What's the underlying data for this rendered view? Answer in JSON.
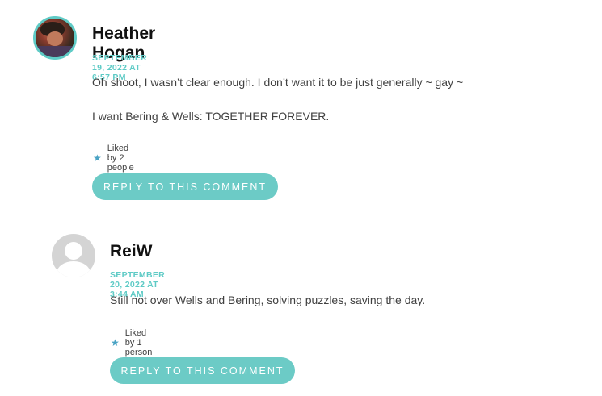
{
  "comments": [
    {
      "author": "Heather Hogan",
      "date": "SEPTEMBER 19, 2022 AT 6:57 PM",
      "paragraphs": [
        "Oh shoot, I wasn’t clear enough. I don’t want it to be just generally ~ gay ~",
        "I want Bering & Wells: TOGETHER FOREVER."
      ],
      "likes": "Liked by 2 people",
      "reply_label": "REPLY TO THIS COMMENT",
      "avatar": "user-photo"
    },
    {
      "author": "ReiW",
      "date": "SEPTEMBER 20, 2022 AT 3:44 AM",
      "paragraphs": [
        "Still not over Wells and Bering, solving puzzles, saving the day."
      ],
      "likes": "Liked by 1 person",
      "reply_label": "REPLY TO THIS COMMENT",
      "avatar": "default-avatar-icon"
    }
  ],
  "colors": {
    "accent": "#5fcbc6",
    "button": "#6ccbc6",
    "star": "#4aa3c4"
  }
}
